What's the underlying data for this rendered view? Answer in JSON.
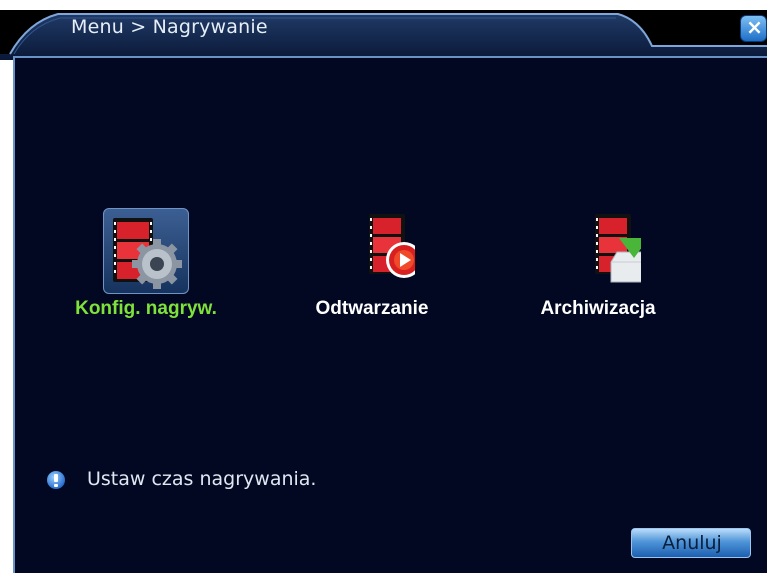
{
  "window": {
    "breadcrumb": "Menu > Nagrywanie",
    "close_glyph": "×"
  },
  "tiles": [
    {
      "label": "Konfig. nagryw.",
      "icon": "film-gear-icon",
      "selected": true
    },
    {
      "label": "Odtwarzanie",
      "icon": "film-play-icon",
      "selected": false
    },
    {
      "label": "Archiwizacja",
      "icon": "film-download-icon",
      "selected": false
    }
  ],
  "hint": {
    "icon": "info-icon",
    "text": "Ustaw czas nagrywania."
  },
  "buttons": {
    "cancel_label": "Anuluj"
  },
  "colors": {
    "panel_background": "#030822",
    "selected_label": "#7ee23a",
    "label": "#ffffff",
    "accent": "#1d6ec8"
  }
}
